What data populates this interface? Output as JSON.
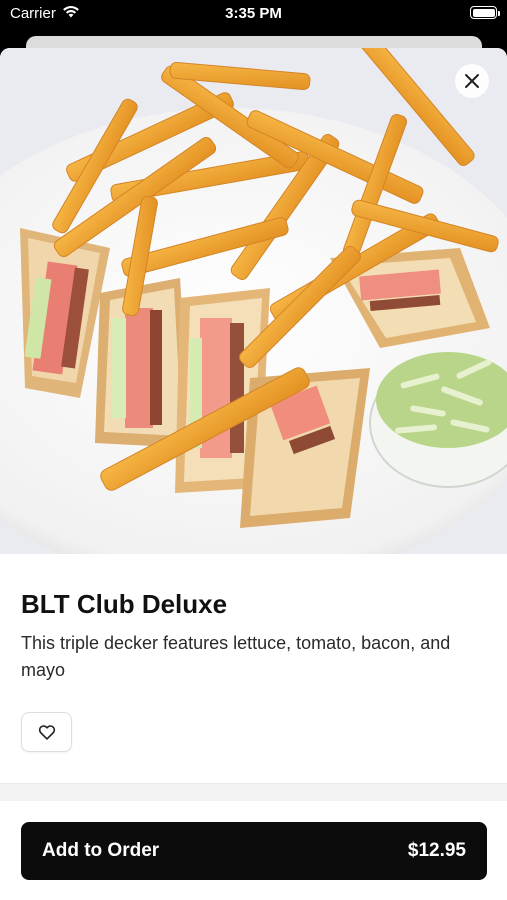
{
  "status_bar": {
    "carrier": "Carrier",
    "time": "3:35 PM"
  },
  "item": {
    "name": "BLT Club Deluxe",
    "description": "This triple decker features lettuce, tomato, bacon, and mayo",
    "image_icon": "food-photo"
  },
  "actions": {
    "close_icon": "close-icon",
    "favorite_icon": "heart-icon",
    "add_label": "Add to Order",
    "price": "$12.95"
  },
  "colors": {
    "button_bg": "#0c0c0c",
    "sheet_bg": "#ffffff",
    "status_bg": "#000000"
  }
}
